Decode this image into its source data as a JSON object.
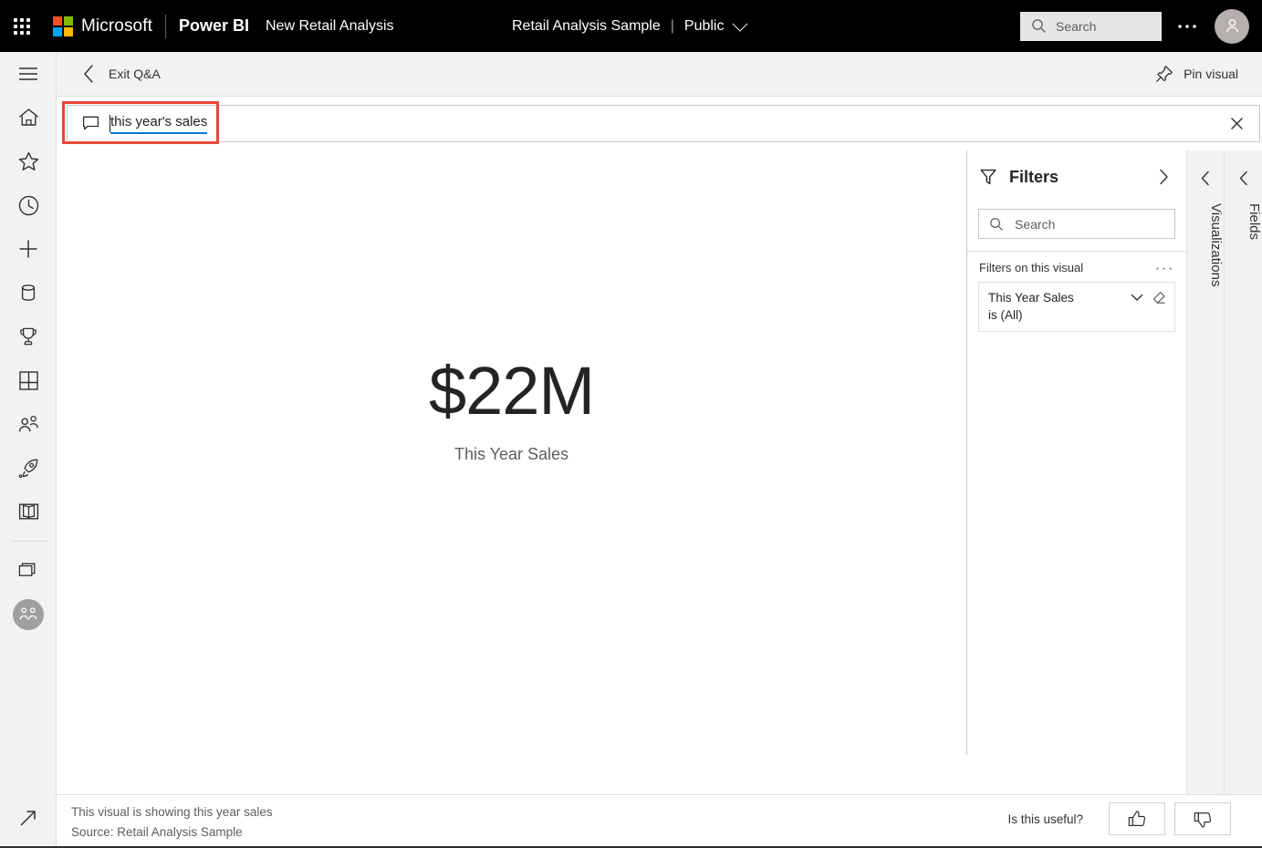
{
  "header": {
    "waffle_label": "app-launcher",
    "microsoft_label": "Microsoft",
    "product_name": "Power BI",
    "report_name": "New Retail Analysis",
    "workspace_name": "Retail Analysis Sample",
    "workspace_separator": "|",
    "workspace_type": "Public",
    "search_placeholder": "Search",
    "more_label": "···"
  },
  "left_nav": {
    "items": [
      {
        "name": "navigation-menu",
        "label": "Navigation"
      },
      {
        "name": "home",
        "label": "Home"
      },
      {
        "name": "favorites",
        "label": "Favorites"
      },
      {
        "name": "recent",
        "label": "Recent"
      },
      {
        "name": "create",
        "label": "Create"
      },
      {
        "name": "datahub",
        "label": "Data hub"
      },
      {
        "name": "goals",
        "label": "Goals"
      },
      {
        "name": "apps",
        "label": "Apps"
      },
      {
        "name": "shared-with-me",
        "label": "Shared with me"
      },
      {
        "name": "deployment-pipelines",
        "label": "Deployment pipelines"
      },
      {
        "name": "learn",
        "label": "Learn"
      },
      {
        "name": "workspaces",
        "label": "Workspaces"
      },
      {
        "name": "current-workspace",
        "label": "Retail Analysis Sample"
      }
    ],
    "expand_label": "Expand"
  },
  "command_bar": {
    "exit_label": "Exit Q&A",
    "pin_label": "Pin visual"
  },
  "qna": {
    "question": "this year's sales",
    "clear_label": "Clear",
    "chat_icon": "qna-chat-icon"
  },
  "visual": {
    "value": "$22M",
    "label": "This Year Sales"
  },
  "filters": {
    "title": "Filters",
    "search_placeholder": "Search",
    "section_label": "Filters on this visual",
    "more_label": "···",
    "cards": [
      {
        "field": "This Year Sales",
        "state": "is (All)"
      }
    ]
  },
  "right_panes": [
    {
      "name": "visualizations",
      "label": "Visualizations"
    },
    {
      "name": "fields",
      "label": "Fields"
    }
  ],
  "footer": {
    "line1": "This visual is showing this year sales",
    "line2": "Source: Retail Analysis Sample",
    "useful_label": "Is this useful?",
    "thumbs_up_label": "Yes",
    "thumbs_down_label": "No"
  },
  "colors": {
    "header_bg": "#000000",
    "chrome_bg": "#f3f2f1",
    "accent": "#0078d4",
    "highlight": "#e8463a",
    "text_primary": "#252423",
    "text_secondary": "#605e5c"
  },
  "chart_data": {
    "type": "table",
    "title": "This Year Sales",
    "categories": [
      "This Year Sales"
    ],
    "values": [
      22000000
    ],
    "display_values": [
      "$22M"
    ]
  }
}
